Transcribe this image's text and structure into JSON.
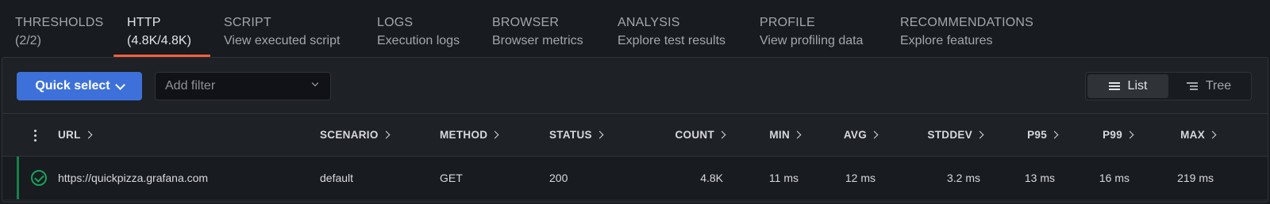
{
  "tabs": [
    {
      "label": "THRESHOLDS",
      "sub": "(2/2)",
      "active": false
    },
    {
      "label": "HTTP",
      "sub": "(4.8K/4.8K)",
      "active": true
    },
    {
      "label": "SCRIPT",
      "sub": "View executed script",
      "active": false
    },
    {
      "label": "LOGS",
      "sub": "Execution logs",
      "active": false
    },
    {
      "label": "BROWSER",
      "sub": "Browser metrics",
      "active": false
    },
    {
      "label": "ANALYSIS",
      "sub": "Explore test results",
      "active": false
    },
    {
      "label": "PROFILE",
      "sub": "View profiling data",
      "active": false
    },
    {
      "label": "RECOMMENDATIONS",
      "sub": "Explore features",
      "active": false
    }
  ],
  "toolbar": {
    "quick_select": "Quick select",
    "filter_placeholder": "Add filter",
    "view_list": "List",
    "view_tree": "Tree",
    "active_view": "List"
  },
  "table": {
    "columns": [
      "URL",
      "SCENARIO",
      "METHOD",
      "STATUS",
      "COUNT",
      "MIN",
      "AVG",
      "STDDEV",
      "P95",
      "P99",
      "MAX"
    ],
    "rows": [
      {
        "status_icon": "check-circle-icon",
        "url": "https://quickpizza.grafana.com",
        "scenario": "default",
        "method": "GET",
        "status": "200",
        "count": "4.8K",
        "min": "11 ms",
        "avg": "12 ms",
        "stddev": "3.2 ms",
        "p95": "13 ms",
        "p99": "16 ms",
        "max": "219 ms"
      }
    ]
  },
  "colors": {
    "accent_tab": "#f55f3e",
    "primary_button": "#3d71d9",
    "success": "#1a9f5d"
  }
}
